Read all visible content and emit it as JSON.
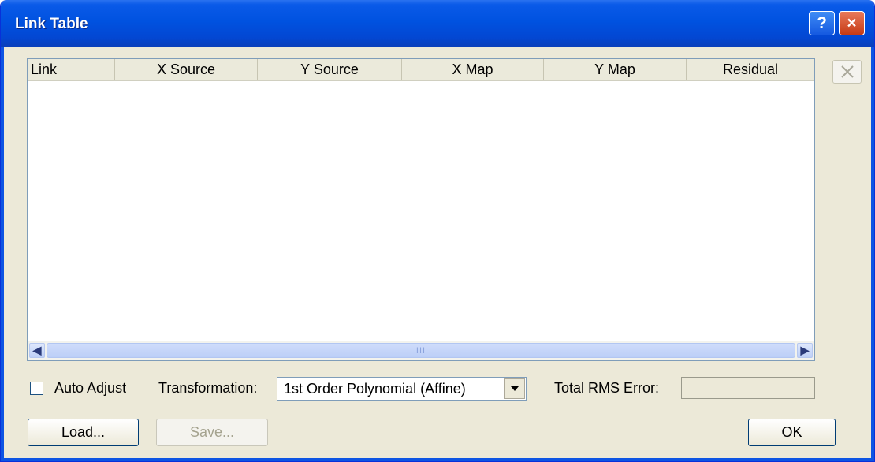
{
  "window": {
    "title": "Link Table",
    "help_glyph": "?",
    "close_glyph": "×"
  },
  "table": {
    "columns": [
      "Link",
      "X Source",
      "Y Source",
      "X Map",
      "Y Map",
      "Residual"
    ],
    "rows": [],
    "scroll_left_glyph": "◀",
    "scroll_right_glyph": "▶",
    "scroll_thumb_grip": "III"
  },
  "delete_link_button": {
    "icon": "delete-x-icon",
    "enabled": false
  },
  "auto_adjust": {
    "label": "Auto Adjust",
    "checked": false
  },
  "transformation": {
    "label": "Transformation:",
    "selected": "1st Order Polynomial (Affine)"
  },
  "rms": {
    "label": "Total RMS Error:",
    "value": ""
  },
  "buttons": {
    "load": "Load...",
    "save": "Save...",
    "ok": "OK"
  },
  "colors": {
    "titlebar": "#0052e0",
    "dialog_face": "#ece9d8",
    "border": "#0831d9"
  }
}
